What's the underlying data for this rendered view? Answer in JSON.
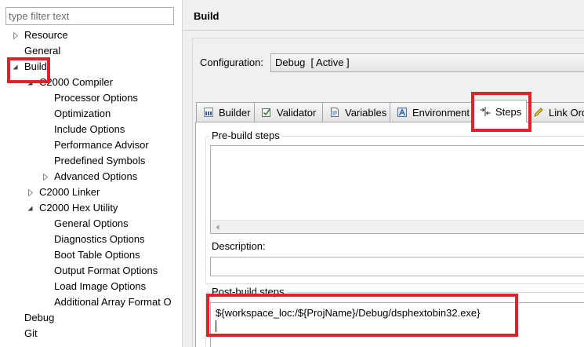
{
  "filter": {
    "placeholder": "type filter text",
    "value": ""
  },
  "tree": {
    "items": [
      {
        "label": "Resource",
        "expanded": false
      },
      {
        "label": "General"
      },
      {
        "label": "Build",
        "expanded": true,
        "children": [
          {
            "label": "C2000 Compiler",
            "expanded": true,
            "children": [
              {
                "label": "Processor Options"
              },
              {
                "label": "Optimization"
              },
              {
                "label": "Include Options"
              },
              {
                "label": "Performance Advisor"
              },
              {
                "label": "Predefined Symbols"
              },
              {
                "label": "Advanced Options",
                "expanded": false
              }
            ]
          },
          {
            "label": "C2000 Linker",
            "expanded": false
          },
          {
            "label": "C2000 Hex Utility",
            "expanded": true,
            "children": [
              {
                "label": "General Options"
              },
              {
                "label": "Diagnostics Options"
              },
              {
                "label": "Boot Table Options"
              },
              {
                "label": "Output Format Options"
              },
              {
                "label": "Load Image Options"
              },
              {
                "label": "Additional Array Format O"
              }
            ]
          }
        ]
      },
      {
        "label": "Debug"
      },
      {
        "label": "Git"
      }
    ]
  },
  "page": {
    "title": "Build"
  },
  "configuration": {
    "label": "Configuration:",
    "value": "Debug  [ Active ]"
  },
  "tabs": [
    {
      "label": "Builder",
      "icon": "builder-icon",
      "selected": false
    },
    {
      "label": "Validator",
      "icon": "validator-icon",
      "selected": false
    },
    {
      "label": "Variables",
      "icon": "variables-icon",
      "selected": false
    },
    {
      "label": "Environment",
      "icon": "environment-icon",
      "selected": false
    },
    {
      "label": "Steps",
      "icon": "steps-icon",
      "selected": true
    },
    {
      "label": "Link Ord",
      "icon": "link-order-icon",
      "selected": false
    }
  ],
  "steps": {
    "pre_build": {
      "group_label": "Pre-build steps",
      "command": "",
      "description_label": "Description:",
      "description": ""
    },
    "post_build": {
      "group_label": "Post-build steps",
      "command": "${workspace_loc:/${ProjName}/Debug/dsphextobin32.exe}"
    }
  },
  "icons": {
    "tree_collapsed": "collapsed-arrow-icon",
    "tree_expanded": "expanded-arrow-icon",
    "scroll_left": "scroll-left-arrow-icon"
  },
  "colors": {
    "annotation": "#e5202b",
    "window_bg": "#f0f0f0",
    "tree_bg": "#ffffff",
    "selected_tab_bg": "#ffffff",
    "tab_border": "#a7a7a7",
    "group_border": "#d5dfe5"
  }
}
